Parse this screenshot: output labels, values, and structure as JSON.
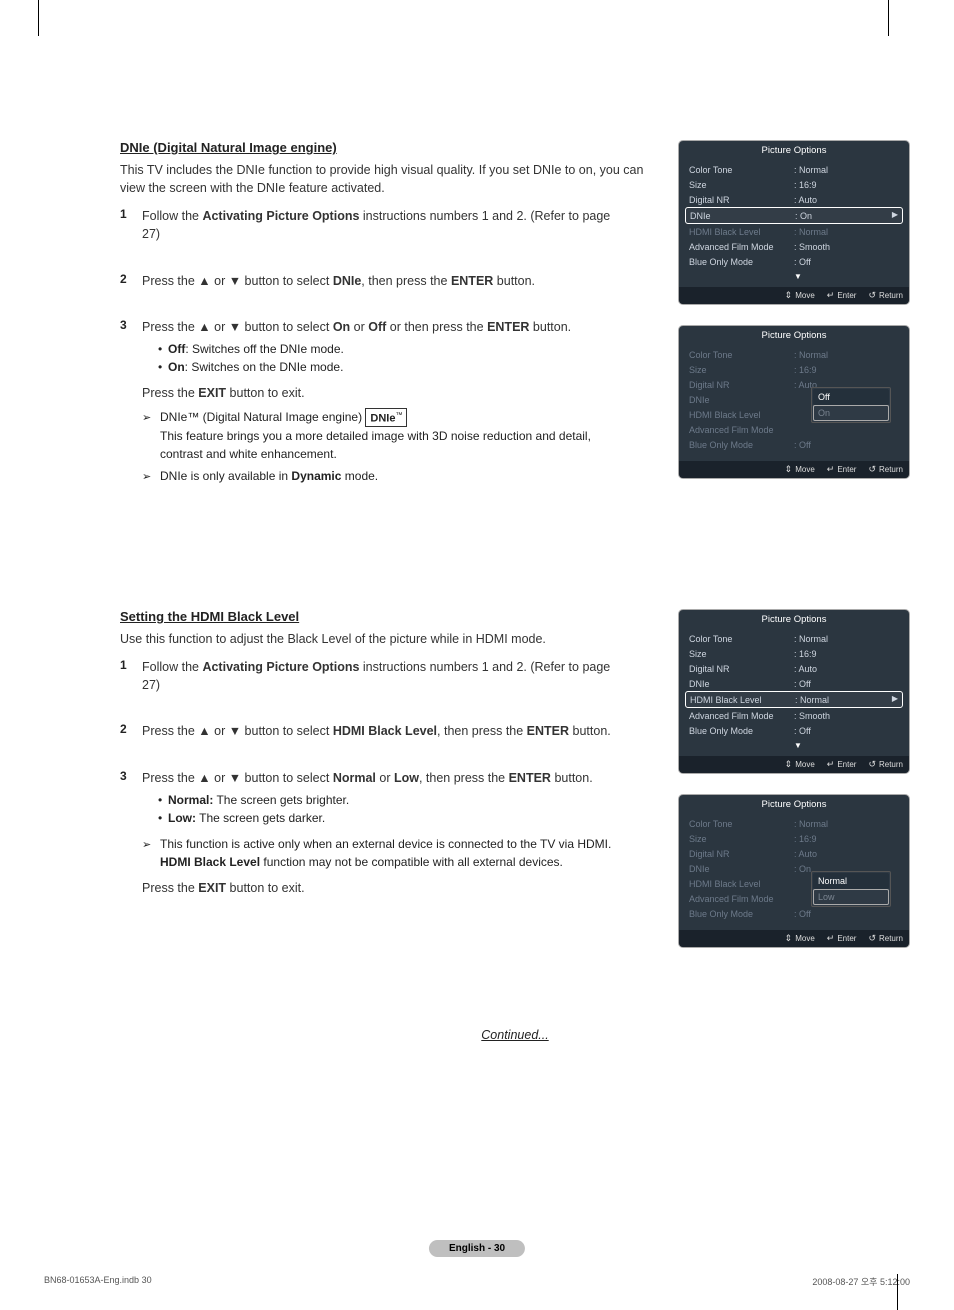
{
  "section1": {
    "title": "DNIe (Digital Natural Image engine)",
    "intro": "This TV includes the DNIe function to provide high visual quality. If you set DNIe to on, you can view the screen with the DNIe feature activated.",
    "steps": {
      "one_pre": "Follow the ",
      "one_bold": "Activating Picture Options",
      "one_post": " instructions numbers 1 and 2. (Refer to page 27)",
      "two_a": "Press the ▲ or ▼ button to select ",
      "two_b": "DNIe",
      "two_c": ", then press the ",
      "two_d": "ENTER",
      "two_e": " button.",
      "three_a": "Press the ▲ or ▼ button to select ",
      "three_b": "On",
      "three_c": " or ",
      "three_d": "Off",
      "three_e": " or then press the ",
      "three_f": "ENTER",
      "three_g": " button.",
      "bullet_off_b": "Off",
      "bullet_off_t": ": Switches off the DNIe mode.",
      "bullet_on_b": "On",
      "bullet_on_t": ": Switches on the DNIe mode.",
      "exit_a": "Press the ",
      "exit_b": "EXIT",
      "exit_c": " button to exit.",
      "note1_a": "DNIe™ (Digital Natural Image engine) ",
      "note1_logo": "DNIe",
      "note1_tm": "™",
      "note1_b": "This feature brings you a more detailed image with 3D noise reduction and detail, contrast and white enhancement.",
      "note2_a": "DNIe is only available in ",
      "note2_b": "Dynamic",
      "note2_c": " mode."
    }
  },
  "section2": {
    "title": "Setting the HDMI Black Level",
    "intro": "Use this function to adjust the Black Level of the picture while in HDMI mode.",
    "steps": {
      "one_pre": "Follow the ",
      "one_bold": "Activating Picture Options",
      "one_post": " instructions numbers 1 and 2. (Refer to page 27)",
      "two_a": "Press the ▲ or ▼ button to select ",
      "two_b": "HDMI Black Level",
      "two_c": ", then press the ",
      "two_d": "ENTER",
      "two_e": " button.",
      "three_a": "Press the ▲ or ▼ button to select ",
      "three_b": "Normal",
      "three_c": " or ",
      "three_d": "Low",
      "three_e": ", then press the ",
      "three_f": "ENTER",
      "three_g": " button.",
      "bullet_n_b": "Normal:",
      "bullet_n_t": " The screen gets brighter.",
      "bullet_l_b": "Low:",
      "bullet_l_t": " The screen gets darker.",
      "note1_a": "This function is active only when an external device is connected to the TV via HDMI.",
      "note1_b_b": "HDMI Black Level",
      "note1_b_t": " function may not be compatible with all external devices.",
      "exit_a": "Press the ",
      "exit_b": "EXIT",
      "exit_c": " button to exit."
    }
  },
  "continued": "Continued...",
  "page_label": "English - 30",
  "meta": {
    "left": "BN68-01653A-Eng.indb   30",
    "right": "2008-08-27   오후 5:12:00"
  },
  "osd_common": {
    "title": "Picture Options",
    "rows": {
      "color_tone": "Color Tone",
      "size": "Size",
      "digital_nr": "Digital NR",
      "dnie": "DNIe",
      "hdmi": "HDMI Black Level",
      "adv": "Advanced Film Mode",
      "blue": "Blue Only Mode"
    },
    "footer": {
      "move": "Move",
      "enter": "Enter",
      "return": "Return"
    }
  },
  "osd1": {
    "color_tone": ": Normal",
    "size": ": 16:9",
    "digital_nr": ": Auto",
    "dnie": ": On",
    "hdmi": ": Normal",
    "adv": ": Smooth",
    "blue": ": Off"
  },
  "osd2": {
    "color_tone": ": Normal",
    "size": ": 16:9",
    "digital_nr": ": Auto",
    "dnie": "",
    "hdmi": "",
    "adv": "",
    "blue": ": Off",
    "opt_off": "Off",
    "opt_on": "On"
  },
  "osd3": {
    "color_tone": ": Normal",
    "size": ": 16:9",
    "digital_nr": ": Auto",
    "dnie": ": Off",
    "hdmi": ": Normal",
    "adv": ": Smooth",
    "blue": ": Off"
  },
  "osd4": {
    "color_tone": ": Normal",
    "size": ": 16:9",
    "digital_nr": ": Auto",
    "dnie": ": On",
    "hdmi": "",
    "adv": "",
    "blue": ": Off",
    "opt_normal": "Normal",
    "opt_low": "Low"
  }
}
